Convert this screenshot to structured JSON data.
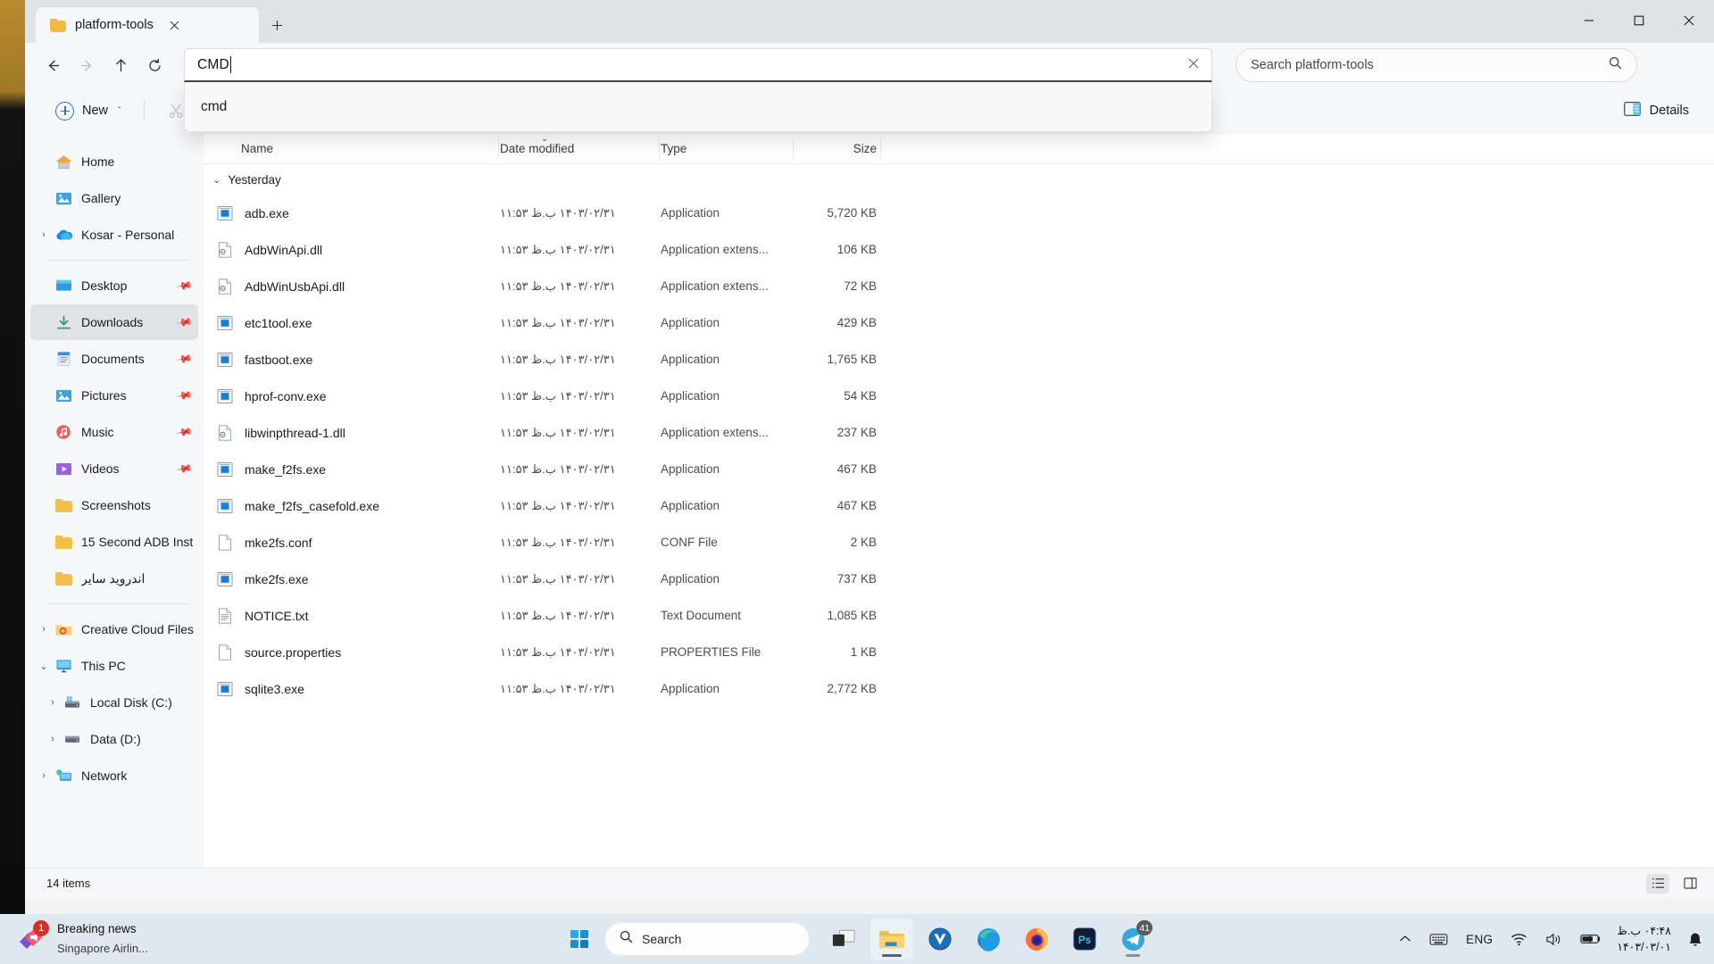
{
  "window": {
    "tab_title": "platform-tools",
    "tab_close_icon": "close-icon",
    "new_tab_icon": "plus-icon",
    "minimize_icon": "minimize-icon",
    "maximize_icon": "maximize-icon",
    "close_icon": "close-icon"
  },
  "nav": {
    "back_icon": "arrow-left-icon",
    "forward_icon": "arrow-right-icon",
    "up_icon": "arrow-up-icon",
    "refresh_icon": "refresh-icon",
    "address_value": "CMD",
    "address_clear_icon": "clear-icon",
    "suggestion": "cmd",
    "search_placeholder": "Search platform-tools",
    "search_icon": "search-icon"
  },
  "toolbar": {
    "new_label": "New",
    "new_chevron": "ˇ",
    "cut_icon": "scissors-icon",
    "copy_icon": "copy-icon",
    "details_label": "Details",
    "details_icon": "details-pane-icon"
  },
  "sidebar": {
    "items": [
      {
        "label": "Home",
        "icon": "home-icon",
        "twisty": "",
        "pinned": false,
        "selected": false,
        "indent": 0
      },
      {
        "label": "Gallery",
        "icon": "gallery-icon",
        "twisty": "",
        "pinned": false,
        "selected": false,
        "indent": 0
      },
      {
        "label": "Kosar - Personal",
        "icon": "onedrive-icon",
        "twisty": "›",
        "pinned": false,
        "selected": false,
        "indent": 0
      },
      {
        "label": "Desktop",
        "icon": "desktop-icon",
        "twisty": "",
        "pinned": true,
        "selected": false,
        "indent": 0
      },
      {
        "label": "Downloads",
        "icon": "downloads-icon",
        "twisty": "",
        "pinned": true,
        "selected": true,
        "indent": 0
      },
      {
        "label": "Documents",
        "icon": "documents-icon",
        "twisty": "",
        "pinned": true,
        "selected": false,
        "indent": 0
      },
      {
        "label": "Pictures",
        "icon": "pictures-icon",
        "twisty": "",
        "pinned": true,
        "selected": false,
        "indent": 0
      },
      {
        "label": "Music",
        "icon": "music-icon",
        "twisty": "",
        "pinned": true,
        "selected": false,
        "indent": 0
      },
      {
        "label": "Videos",
        "icon": "videos-icon",
        "twisty": "",
        "pinned": true,
        "selected": false,
        "indent": 0
      },
      {
        "label": "Screenshots",
        "icon": "folder-icon",
        "twisty": "",
        "pinned": false,
        "selected": false,
        "indent": 0
      },
      {
        "label": "15 Second ADB Inst",
        "icon": "folder-icon",
        "twisty": "",
        "pinned": false,
        "selected": false,
        "indent": 0
      },
      {
        "label": "اندروید سایر",
        "icon": "folder-icon",
        "twisty": "",
        "pinned": false,
        "selected": false,
        "indent": 0,
        "rtl": true
      },
      {
        "label": "Creative Cloud Files",
        "icon": "creative-cloud-icon",
        "twisty": "›",
        "pinned": false,
        "selected": false,
        "indent": 0
      },
      {
        "label": "This PC",
        "icon": "this-pc-icon",
        "twisty": "⌄",
        "pinned": false,
        "selected": false,
        "indent": 0
      },
      {
        "label": "Local Disk (C:)",
        "icon": "system-drive-icon",
        "twisty": "›",
        "pinned": false,
        "selected": false,
        "indent": 1
      },
      {
        "label": "Data (D:)",
        "icon": "drive-icon",
        "twisty": "›",
        "pinned": false,
        "selected": false,
        "indent": 1
      },
      {
        "label": "Network",
        "icon": "network-icon",
        "twisty": "›",
        "pinned": false,
        "selected": false,
        "indent": 0
      }
    ],
    "separator_after": [
      2,
      11
    ]
  },
  "filelist": {
    "columns": [
      "Name",
      "Date modified",
      "Type",
      "Size"
    ],
    "sort_column": "Date modified",
    "sort_chevron": "⌄",
    "group": {
      "label": "Yesterday",
      "chevron": "⌄"
    },
    "rows": [
      {
        "name": "adb.exe",
        "date": "۱۴۰۳/۰۲/۳۱ ب.ظ ۱۱:۵۳",
        "type": "Application",
        "size": "5,720 KB",
        "icon": "exe-icon"
      },
      {
        "name": "AdbWinApi.dll",
        "date": "۱۴۰۳/۰۲/۳۱ ب.ظ ۱۱:۵۳",
        "type": "Application extens...",
        "size": "106 KB",
        "icon": "dll-icon"
      },
      {
        "name": "AdbWinUsbApi.dll",
        "date": "۱۴۰۳/۰۲/۳۱ ب.ظ ۱۱:۵۳",
        "type": "Application extens...",
        "size": "72 KB",
        "icon": "dll-icon"
      },
      {
        "name": "etc1tool.exe",
        "date": "۱۴۰۳/۰۲/۳۱ ب.ظ ۱۱:۵۳",
        "type": "Application",
        "size": "429 KB",
        "icon": "exe-icon"
      },
      {
        "name": "fastboot.exe",
        "date": "۱۴۰۳/۰۲/۳۱ ب.ظ ۱۱:۵۳",
        "type": "Application",
        "size": "1,765 KB",
        "icon": "exe-icon"
      },
      {
        "name": "hprof-conv.exe",
        "date": "۱۴۰۳/۰۲/۳۱ ب.ظ ۱۱:۵۳",
        "type": "Application",
        "size": "54 KB",
        "icon": "exe-icon"
      },
      {
        "name": "libwinpthread-1.dll",
        "date": "۱۴۰۳/۰۲/۳۱ ب.ظ ۱۱:۵۳",
        "type": "Application extens...",
        "size": "237 KB",
        "icon": "dll-icon"
      },
      {
        "name": "make_f2fs.exe",
        "date": "۱۴۰۳/۰۲/۳۱ ب.ظ ۱۱:۵۳",
        "type": "Application",
        "size": "467 KB",
        "icon": "exe-icon"
      },
      {
        "name": "make_f2fs_casefold.exe",
        "date": "۱۴۰۳/۰۲/۳۱ ب.ظ ۱۱:۵۳",
        "type": "Application",
        "size": "467 KB",
        "icon": "exe-icon"
      },
      {
        "name": "mke2fs.conf",
        "date": "۱۴۰۳/۰۲/۳۱ ب.ظ ۱۱:۵۳",
        "type": "CONF File",
        "size": "2 KB",
        "icon": "blank-file-icon"
      },
      {
        "name": "mke2fs.exe",
        "date": "۱۴۰۳/۰۲/۳۱ ب.ظ ۱۱:۵۳",
        "type": "Application",
        "size": "737 KB",
        "icon": "exe-icon"
      },
      {
        "name": "NOTICE.txt",
        "date": "۱۴۰۳/۰۲/۳۱ ب.ظ ۱۱:۵۳",
        "type": "Text Document",
        "size": "1,085 KB",
        "icon": "text-file-icon"
      },
      {
        "name": "source.properties",
        "date": "۱۴۰۳/۰۲/۳۱ ب.ظ ۱۱:۵۳",
        "type": "PROPERTIES File",
        "size": "1 KB",
        "icon": "blank-file-icon"
      },
      {
        "name": "sqlite3.exe",
        "date": "۱۴۰۳/۰۲/۳۱ ب.ظ ۱۱:۵۳",
        "type": "Application",
        "size": "2,772 KB",
        "icon": "exe-icon"
      }
    ]
  },
  "statusbar": {
    "item_count": "14 items",
    "list_view_icon": "list-view-icon",
    "detail_view_icon": "detail-view-icon"
  },
  "taskbar": {
    "news": {
      "title": "Breaking news",
      "subtitle": "Singapore Airlin...",
      "badge": "1",
      "icon": "news-icon"
    },
    "start_icon": "windows-start-icon",
    "search_label": "Search",
    "search_icon": "search-icon",
    "apps": [
      {
        "name": "task-view",
        "badge": "",
        "active": false,
        "running": false
      },
      {
        "name": "file-explorer",
        "badge": "",
        "active": true,
        "running": true
      },
      {
        "name": "v-app",
        "badge": "",
        "active": false,
        "running": false
      },
      {
        "name": "microsoft-edge",
        "badge": "",
        "active": false,
        "running": true
      },
      {
        "name": "firefox",
        "badge": "",
        "active": false,
        "running": true
      },
      {
        "name": "photoshop",
        "badge": "",
        "active": false,
        "running": true
      },
      {
        "name": "telegram",
        "badge": "41",
        "active": false,
        "running": true
      }
    ],
    "tray": {
      "overflow_icon": "chevron-up-icon",
      "keyboard_icon": "keyboard-icon",
      "language": "ENG",
      "wifi_icon": "wifi-icon",
      "volume_icon": "speaker-icon",
      "battery_icon": "battery-charging-icon",
      "time": "۰۴:۴۸ ب.ظ",
      "date": "۱۴۰۳/۰۳/۰۱",
      "notification_icon": "bell-icon"
    }
  },
  "colors": {
    "accent": "#3a6ea5",
    "window_bg": "#f6f7f8",
    "taskbar_bg": "#dfe8f0",
    "selection": "#e2e3e5"
  }
}
